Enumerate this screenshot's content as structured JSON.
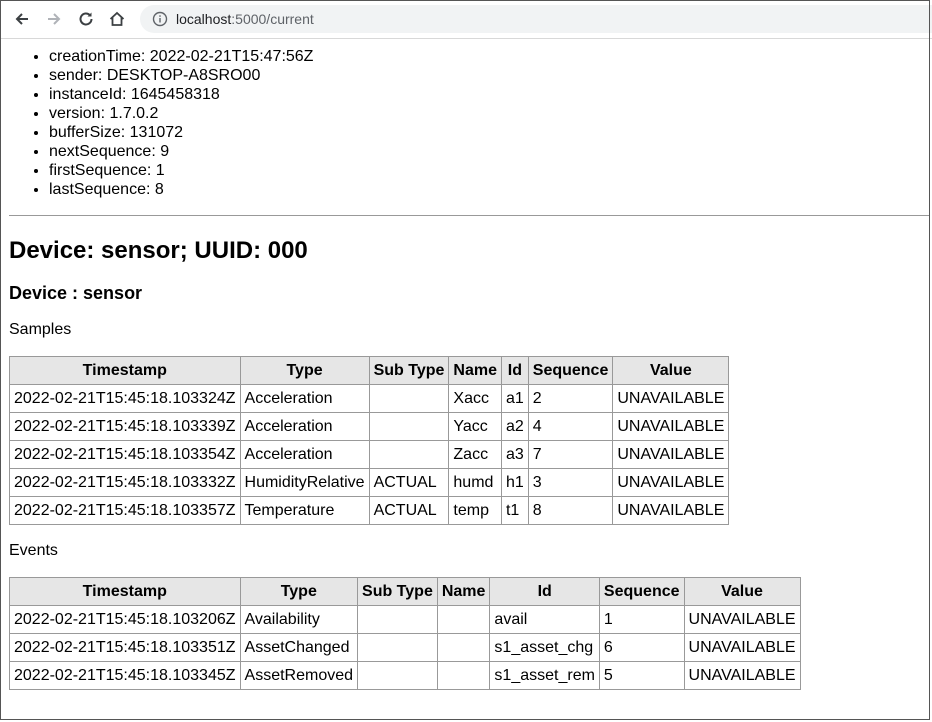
{
  "browser": {
    "url_host": "localhost",
    "url_rest": ":5000/current"
  },
  "header": {
    "items": [
      {
        "key": "creationTime",
        "value": "2022-02-21T15:47:56Z"
      },
      {
        "key": "sender",
        "value": "DESKTOP-A8SRO00"
      },
      {
        "key": "instanceId",
        "value": "1645458318"
      },
      {
        "key": "version",
        "value": "1.7.0.2"
      },
      {
        "key": "bufferSize",
        "value": "131072"
      },
      {
        "key": "nextSequence",
        "value": "9"
      },
      {
        "key": "firstSequence",
        "value": "1"
      },
      {
        "key": "lastSequence",
        "value": "8"
      }
    ]
  },
  "device_heading": "Device: sensor; UUID: 000",
  "component_heading": "Device : sensor",
  "samples": {
    "label": "Samples",
    "columns": [
      "Timestamp",
      "Type",
      "Sub Type",
      "Name",
      "Id",
      "Sequence",
      "Value"
    ],
    "rows": [
      [
        "2022-02-21T15:45:18.103324Z",
        "Acceleration",
        "",
        "Xacc",
        "a1",
        "2",
        "UNAVAILABLE"
      ],
      [
        "2022-02-21T15:45:18.103339Z",
        "Acceleration",
        "",
        "Yacc",
        "a2",
        "4",
        "UNAVAILABLE"
      ],
      [
        "2022-02-21T15:45:18.103354Z",
        "Acceleration",
        "",
        "Zacc",
        "a3",
        "7",
        "UNAVAILABLE"
      ],
      [
        "2022-02-21T15:45:18.103332Z",
        "HumidityRelative",
        "ACTUAL",
        "humd",
        "h1",
        "3",
        "UNAVAILABLE"
      ],
      [
        "2022-02-21T15:45:18.103357Z",
        "Temperature",
        "ACTUAL",
        "temp",
        "t1",
        "8",
        "UNAVAILABLE"
      ]
    ]
  },
  "events": {
    "label": "Events",
    "columns": [
      "Timestamp",
      "Type",
      "Sub Type",
      "Name",
      "Id",
      "Sequence",
      "Value"
    ],
    "rows": [
      [
        "2022-02-21T15:45:18.103206Z",
        "Availability",
        "",
        "",
        "avail",
        "1",
        "UNAVAILABLE"
      ],
      [
        "2022-02-21T15:45:18.103351Z",
        "AssetChanged",
        "",
        "",
        "s1_asset_chg",
        "6",
        "UNAVAILABLE"
      ],
      [
        "2022-02-21T15:45:18.103345Z",
        "AssetRemoved",
        "",
        "",
        "s1_asset_rem",
        "5",
        "UNAVAILABLE"
      ]
    ]
  }
}
